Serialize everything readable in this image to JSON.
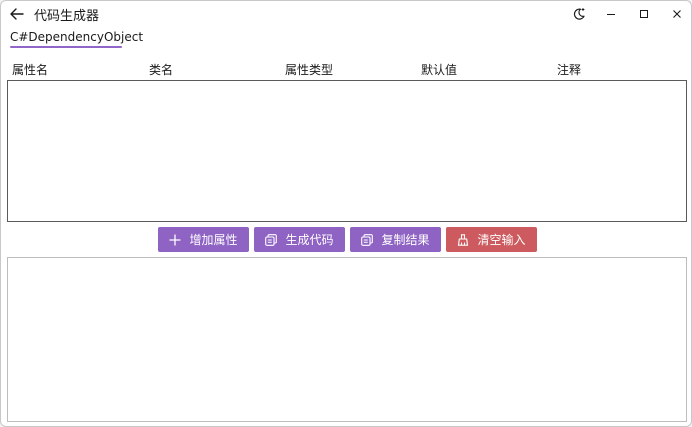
{
  "window": {
    "title": "代码生成器"
  },
  "tab": {
    "label": "C#DependencyObject"
  },
  "columns": [
    "属性名",
    "类名",
    "属性类型",
    "默认值",
    "注释"
  ],
  "buttons": {
    "add": "增加属性",
    "generate": "生成代码",
    "copy": "复制结果",
    "clear": "清空输入"
  },
  "icons": {
    "back": "back-arrow-icon",
    "theme": "moon-icon",
    "minimize": "minimize-icon",
    "maximize": "maximize-icon",
    "close": "close-icon",
    "add": "plus-icon",
    "generate": "copy-icon",
    "copy": "copy-icon",
    "clear": "eraser-icon"
  },
  "colors": {
    "accent": "#8e63c3",
    "danger": "#cc5a5e"
  }
}
